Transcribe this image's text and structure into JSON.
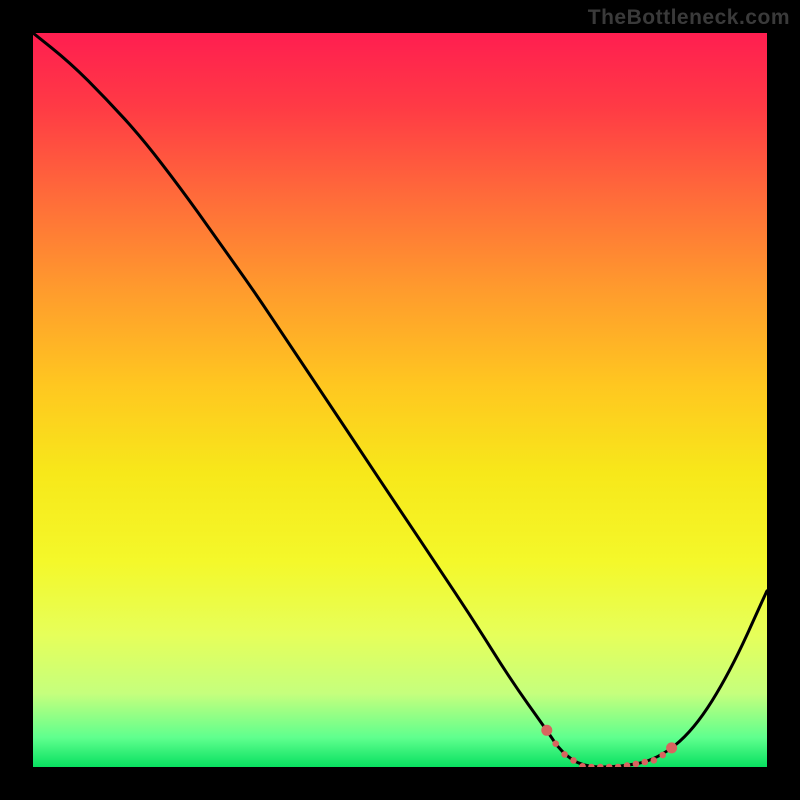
{
  "watermark": "TheBottleneck.com",
  "chart_data": {
    "type": "line",
    "title": "",
    "xlabel": "",
    "ylabel": "",
    "x": [
      0,
      5,
      10,
      15,
      20,
      25,
      30,
      35,
      40,
      45,
      50,
      55,
      60,
      65,
      70,
      72,
      75,
      80,
      85,
      90,
      95,
      100
    ],
    "values": [
      100,
      96,
      91,
      85.5,
      79,
      72,
      65,
      57.5,
      50,
      42.5,
      35,
      27.5,
      20,
      12,
      5,
      2,
      0,
      0,
      1,
      5,
      13,
      24
    ],
    "xlim": [
      0,
      100
    ],
    "ylim": [
      0,
      100
    ],
    "annotations": [
      {
        "type": "dotted-segment",
        "x_start": 70,
        "x_end": 87,
        "color": "#d9645f"
      }
    ]
  },
  "colors": {
    "background": "#000000",
    "curve": "#000000",
    "dot_segment": "#d9645f"
  }
}
